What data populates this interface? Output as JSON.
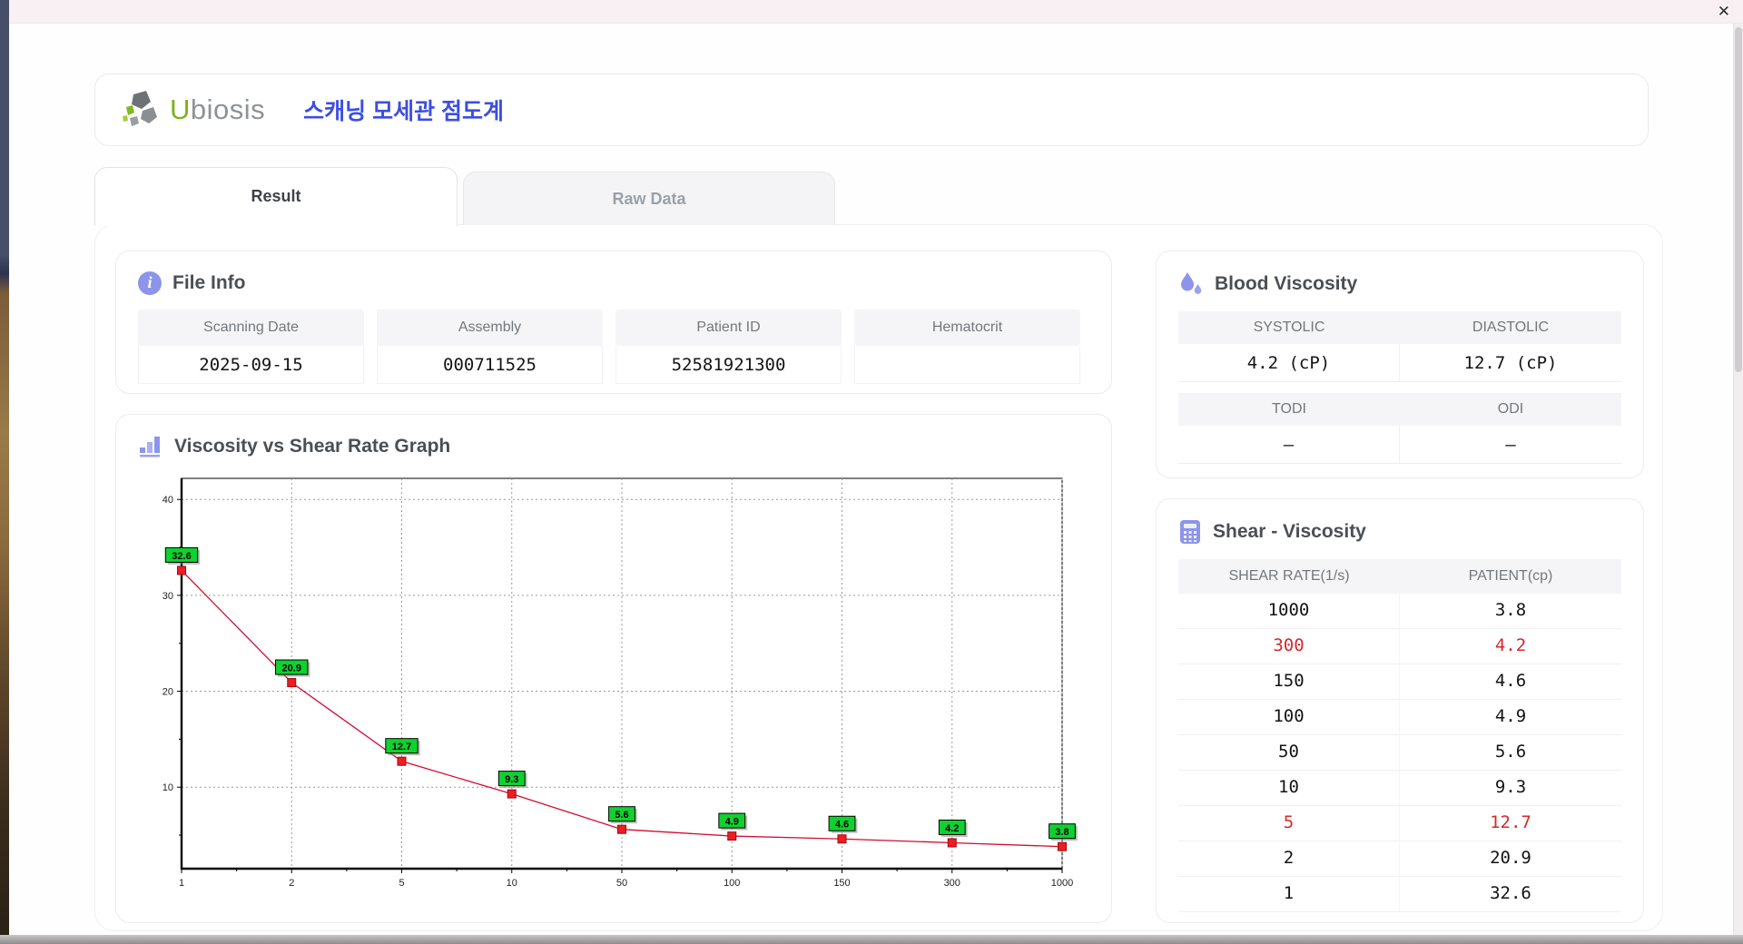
{
  "window": {
    "close_glyph": "✕"
  },
  "header": {
    "logo_u": "U",
    "logo_rest": "biosis",
    "title_ko": "스캐닝 모세관 점도계"
  },
  "icons": {
    "info_glyph": "i"
  },
  "tabs": [
    {
      "label": "Result",
      "active": true
    },
    {
      "label": "Raw Data",
      "active": false
    }
  ],
  "file_info": {
    "title": "File Info",
    "fields": [
      {
        "label": "Scanning Date",
        "value": "2025-09-15"
      },
      {
        "label": "Assembly",
        "value": "000711525"
      },
      {
        "label": "Patient ID",
        "value": "52581921300"
      },
      {
        "label": "Hematocrit",
        "value": ""
      }
    ]
  },
  "blood_viscosity": {
    "title": "Blood Viscosity",
    "tables": [
      {
        "headers": [
          "SYSTOLIC",
          "DIASTOLIC"
        ],
        "values": [
          "4.2 (cP)",
          "12.7 (cP)"
        ]
      },
      {
        "headers": [
          "TODI",
          "ODI"
        ],
        "values": [
          "–",
          "–"
        ]
      }
    ]
  },
  "shear_viscosity": {
    "title": "Shear - Viscosity",
    "headers": [
      "SHEAR RATE(1/s)",
      "PATIENT(cp)"
    ],
    "rows": [
      {
        "shear_rate": "1000",
        "patient": "3.8",
        "highlight": false
      },
      {
        "shear_rate": "300",
        "patient": "4.2",
        "highlight": true
      },
      {
        "shear_rate": "150",
        "patient": "4.6",
        "highlight": false
      },
      {
        "shear_rate": "100",
        "patient": "4.9",
        "highlight": false
      },
      {
        "shear_rate": "50",
        "patient": "5.6",
        "highlight": false
      },
      {
        "shear_rate": "10",
        "patient": "9.3",
        "highlight": false
      },
      {
        "shear_rate": "5",
        "patient": "12.7",
        "highlight": true
      },
      {
        "shear_rate": "2",
        "patient": "20.9",
        "highlight": false
      },
      {
        "shear_rate": "1",
        "patient": "32.6",
        "highlight": false
      }
    ]
  },
  "graph": {
    "title": "Viscosity vs Shear Rate Graph"
  },
  "chart_data": {
    "type": "line",
    "x_categories": [
      1,
      2,
      5,
      10,
      50,
      100,
      150,
      300,
      1000
    ],
    "x_tick_labels": [
      "1",
      "2",
      "5",
      "10",
      "50",
      "100",
      "150",
      "300",
      "1000"
    ],
    "values": [
      32.6,
      20.9,
      12.7,
      9.3,
      5.6,
      4.9,
      4.6,
      4.2,
      3.8
    ],
    "point_labels": [
      "32.6",
      "20.9",
      "12.7",
      "9.3",
      "5.6",
      "4.9",
      "4.6",
      "4.2",
      "3.8"
    ],
    "title": "Viscosity vs Shear Rate Graph",
    "xlabel": "",
    "ylabel": "",
    "ylim": [
      1.5,
      42.2
    ],
    "y_ticks": [
      10,
      20,
      30,
      40
    ],
    "grid": true,
    "legend": false,
    "line_color": "#d40b2e",
    "marker_color": "#ee1c24",
    "marker_edge": "#9e0b10",
    "label_bg": "#0fd12f",
    "label_border": "#000000"
  }
}
